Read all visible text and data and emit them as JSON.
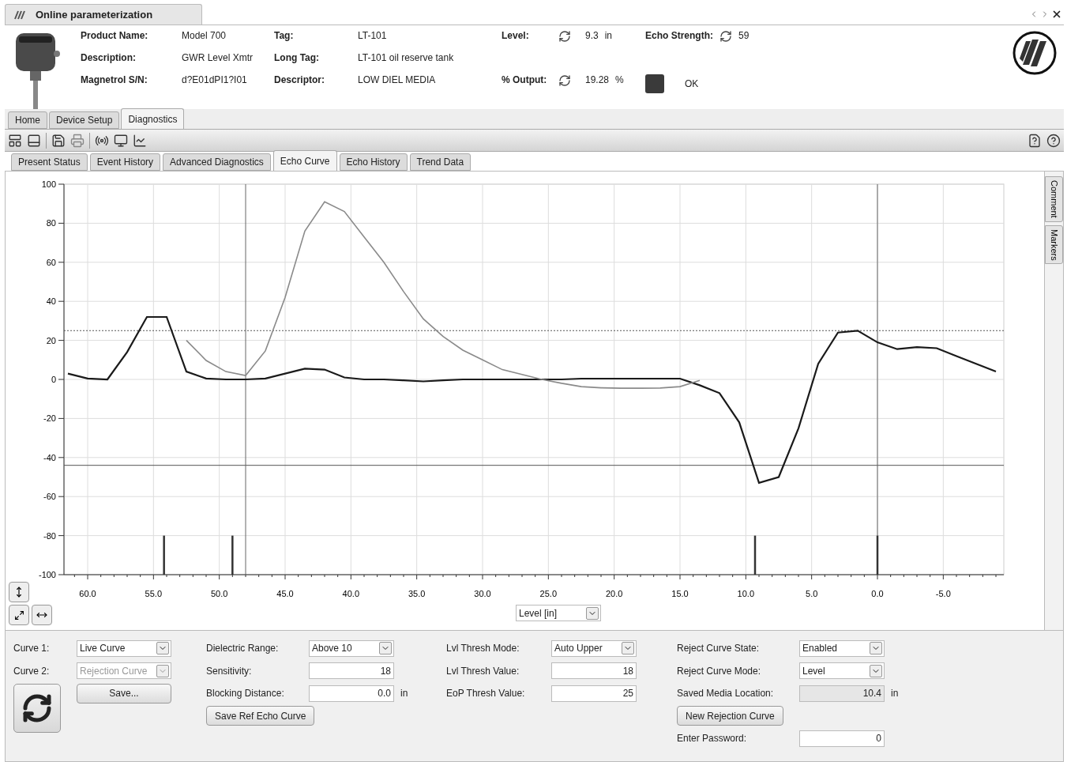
{
  "window": {
    "title": "Online parameterization"
  },
  "device": {
    "fields": [
      {
        "label": "Product Name:",
        "value": "Model 700"
      },
      {
        "label": "Tag:",
        "value": "LT-101"
      },
      {
        "label": "Description:",
        "value": "GWR Level Xmtr"
      },
      {
        "label": "Long Tag:",
        "value": "LT-101 oil reserve tank"
      },
      {
        "label": "Magnetrol S/N:",
        "value": "d?E01dPI1?I01"
      },
      {
        "label": "Descriptor:",
        "value": "LOW DIEL MEDIA"
      }
    ]
  },
  "readings": [
    {
      "label": "Level:",
      "value": "9.3",
      "unit": "in"
    },
    {
      "label": "Echo Strength:",
      "value": "59"
    },
    {
      "label": "% Output:",
      "value": "19.28",
      "unit": "%"
    }
  ],
  "status": {
    "color": "#3a3a3a",
    "text": "OK"
  },
  "main_tabs": [
    {
      "label": "Home",
      "selected": false
    },
    {
      "label": "Device Setup",
      "selected": false
    },
    {
      "label": "Diagnostics",
      "selected": true
    }
  ],
  "sub_tabs": [
    {
      "label": "Present Status",
      "selected": false
    },
    {
      "label": "Event History",
      "selected": false
    },
    {
      "label": "Advanced Diagnostics",
      "selected": false
    },
    {
      "label": "Echo Curve",
      "selected": true
    },
    {
      "label": "Echo History",
      "selected": false
    },
    {
      "label": "Trend Data",
      "selected": false
    }
  ],
  "side_tabs": [
    "Comment",
    "Markers"
  ],
  "chart": {
    "axis_select": "Level [in]",
    "chart_data": {
      "type": "line",
      "x": [
        61.5,
        60,
        58.5,
        57,
        55.5,
        54,
        52.5,
        51,
        49.5,
        48,
        46.5,
        45,
        43.5,
        42,
        40.5,
        39,
        37.5,
        36,
        34.5,
        33,
        31.5,
        30,
        28.5,
        27,
        25.5,
        24,
        22.5,
        21,
        19.5,
        18,
        16.5,
        15,
        13.5,
        12,
        10.5,
        9,
        7.5,
        6,
        4.5,
        3,
        1.5,
        0,
        -1.5,
        -3,
        -4.5,
        -6,
        -7.5,
        -9
      ],
      "series": [
        {
          "color": "#1a1a1a",
          "values": [
            3,
            0.5,
            0,
            14,
            32,
            32,
            4,
            0.5,
            0,
            0,
            0.5,
            3,
            5.5,
            5,
            1,
            0,
            0,
            -0.5,
            -1,
            -0.5,
            0,
            0,
            0,
            0,
            0,
            0,
            0.4,
            0.4,
            0.4,
            0.4,
            0.4,
            0.4,
            -3,
            -7,
            -22,
            -53,
            -50,
            -25,
            8,
            24,
            25,
            19,
            15.5,
            16.5,
            16,
            12,
            8,
            4
          ]
        },
        {
          "color": "#8a8a8a",
          "values": [
            null,
            null,
            null,
            null,
            null,
            null,
            20,
            9.7,
            4,
            2,
            14.6,
            42,
            76,
            91,
            86,
            73,
            60,
            45,
            31,
            22,
            15,
            10,
            5,
            2.5,
            0,
            -2,
            -3.7,
            -4.3,
            -4.5,
            -4.5,
            -4.4,
            -3.7,
            -0.5,
            null,
            null,
            null,
            null,
            null,
            null,
            null,
            null,
            null,
            null,
            null,
            null,
            null,
            null,
            null
          ]
        }
      ],
      "xlim": [
        61.8,
        -9.6
      ],
      "ylim": [
        -100,
        100
      ],
      "xticks": [
        {
          "value": 60,
          "label": "60.0"
        },
        {
          "value": 55,
          "label": "55.0"
        },
        {
          "value": 50,
          "label": "50.0"
        },
        {
          "value": 45,
          "label": "45.0"
        },
        {
          "value": 40,
          "label": "40.0"
        },
        {
          "value": 35,
          "label": "35.0"
        },
        {
          "value": 30,
          "label": "30.0"
        },
        {
          "value": 25,
          "label": "25.0"
        },
        {
          "value": 20,
          "label": "20.0"
        },
        {
          "value": 15,
          "label": "15.0"
        },
        {
          "value": 10,
          "label": "10.0"
        },
        {
          "value": 5,
          "label": "5.0"
        },
        {
          "value": 0,
          "label": "0.0"
        },
        {
          "value": -5,
          "label": "-5.0"
        }
      ],
      "yticks": [
        -100,
        -80,
        -60,
        -40,
        -20,
        0,
        20,
        40,
        60,
        80,
        100
      ],
      "grid": true,
      "ref_lines": [
        {
          "axis": "y",
          "value": 25
        },
        {
          "axis": "y",
          "value": -44
        },
        {
          "axis": "x",
          "value": 48
        },
        {
          "axis": "x",
          "value": 0
        }
      ]
    }
  },
  "curves": [
    {
      "label": "Curve 1:",
      "value": "Live Curve",
      "disabled": false
    },
    {
      "label": "Curve 2:",
      "value": "Rejection Curve",
      "disabled": true
    }
  ],
  "save_button": "Save...",
  "form_columns": [
    [
      {
        "kind": "select",
        "label": "Dielectric Range:",
        "value": "Above 10"
      },
      {
        "kind": "input",
        "label": "Sensitivity:",
        "value": "18"
      },
      {
        "kind": "input",
        "label": "Blocking Distance:",
        "value": "0.0",
        "unit": "in"
      },
      {
        "kind": "button",
        "label": "Save Ref Echo Curve"
      }
    ],
    [
      {
        "kind": "select",
        "label": "Lvl Thresh Mode:",
        "value": "Auto Upper"
      },
      {
        "kind": "input",
        "label": "Lvl Thresh Value:",
        "value": "18"
      },
      {
        "kind": "input",
        "label": "EoP Thresh Value:",
        "value": "25"
      }
    ],
    [
      {
        "kind": "select",
        "label": "Reject Curve State:",
        "value": "Enabled"
      },
      {
        "kind": "select",
        "label": "Reject Curve Mode:",
        "value": "Level"
      },
      {
        "kind": "readonly",
        "label": "Saved Media Location:",
        "value": "10.4",
        "unit": "in"
      },
      {
        "kind": "button",
        "label": "New Rejection Curve"
      },
      {
        "kind": "input",
        "label": "Enter Password:",
        "value": "0"
      }
    ]
  ]
}
